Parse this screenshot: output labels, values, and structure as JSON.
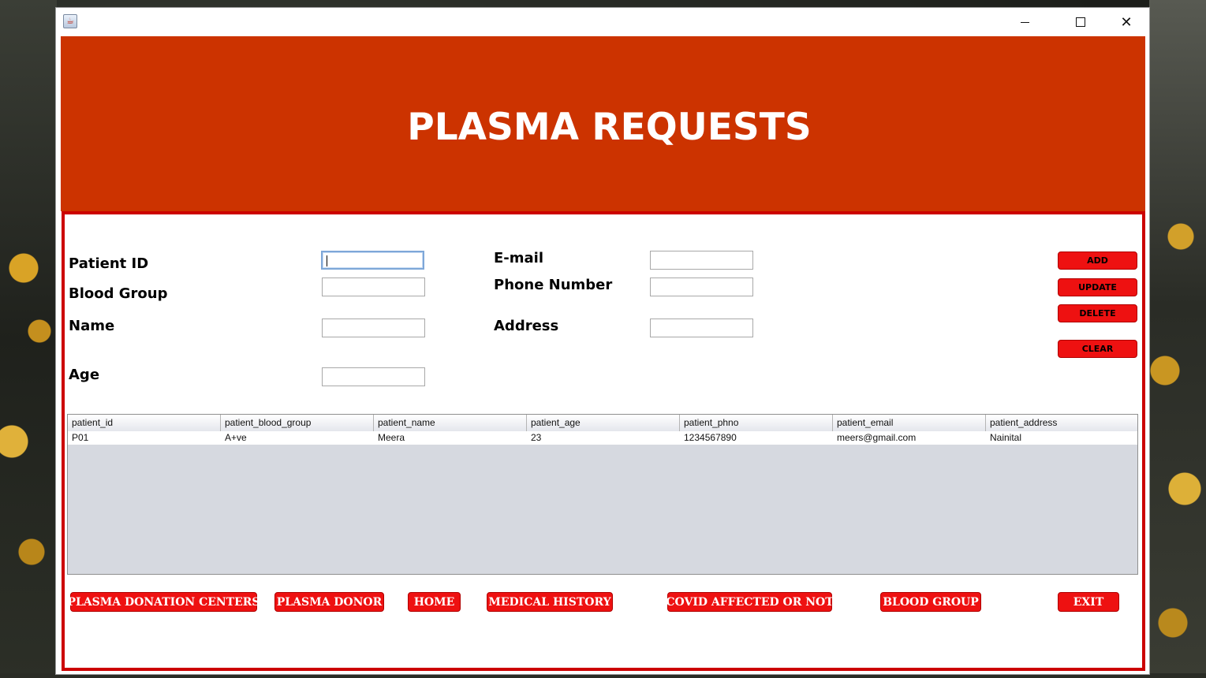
{
  "window": {
    "icon": "java-app-icon",
    "controls": {
      "minimize": "minimize-icon",
      "maximize": "maximize-icon",
      "close": "close-icon",
      "close_glyph": "✕"
    }
  },
  "header": {
    "title": "PLASMA REQUESTS",
    "color": "#cc3300"
  },
  "form": {
    "patient_id": {
      "label": "Patient ID",
      "value": ""
    },
    "blood_group": {
      "label": "Blood Group",
      "value": ""
    },
    "name": {
      "label": "Name",
      "value": ""
    },
    "age": {
      "label": "Age",
      "value": ""
    },
    "email": {
      "label": "E-mail",
      "value": ""
    },
    "phone": {
      "label": "Phone Number",
      "value": ""
    },
    "address": {
      "label": "Address",
      "value": ""
    }
  },
  "actions": {
    "add": "ADD",
    "update": "UPDATE",
    "delete": "DELETE",
    "clear": "CLEAR"
  },
  "table": {
    "columns": [
      "patient_id",
      "patient_blood_group",
      "patient_name",
      "patient_age",
      "patient_phno",
      "patient_email",
      "patient_address"
    ],
    "rows": [
      [
        "P01",
        "A+ve",
        "Meera",
        "23",
        "1234567890",
        "meers@gmail.com",
        "Nainital"
      ]
    ]
  },
  "nav": {
    "donation_centers": "PLASMA DONATION CENTERS",
    "donor": "PLASMA DONOR",
    "home": "HOME",
    "medical_history": "MEDICAL HISTORY",
    "covid": "COVID AFFECTED OR NOT",
    "blood_group": "BLOOD GROUP",
    "exit": "EXIT"
  },
  "colors": {
    "accent": "#ee1111",
    "border": "#cc0000",
    "table_bg": "#d6d9e0"
  }
}
